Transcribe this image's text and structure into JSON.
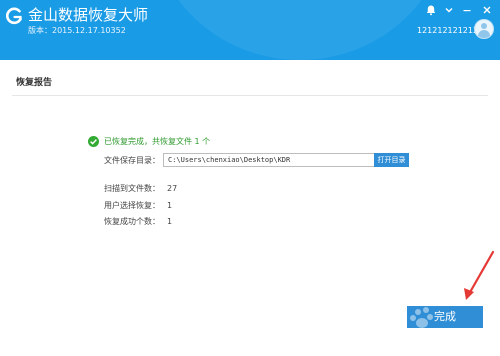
{
  "window": {
    "title": "金山数据恢复大师",
    "version": "版本：2015.12.17.10352",
    "username": "121212121212",
    "colors": {
      "titlebar": "#1a9be6",
      "accent_button": "#2f8ed6",
      "success": "#33aa33",
      "annotation_arrow": "#e53935"
    }
  },
  "window_controls": {
    "items": [
      {
        "name": "notification-icon",
        "glyph": "🔔"
      },
      {
        "name": "menu-icon",
        "glyph": "▾"
      },
      {
        "name": "minimize-icon",
        "glyph": "—"
      },
      {
        "name": "close-icon",
        "glyph": "✕"
      }
    ]
  },
  "report": {
    "section_title": "恢复报告",
    "success_message": "已恢复完成，共恢复文件 1 个",
    "save_dir_label": "文件保存目录：",
    "save_dir_value": "C:\\Users\\chenxiao\\Desktop\\KDR",
    "open_dir_button": "打开目录",
    "stats": [
      {
        "label": "扫描到文件数：",
        "value": "27"
      },
      {
        "label": "用户选择恢复：",
        "value": "1"
      },
      {
        "label": "恢复成功个数：",
        "value": "1"
      }
    ]
  },
  "footer": {
    "finish_button": "完成"
  }
}
